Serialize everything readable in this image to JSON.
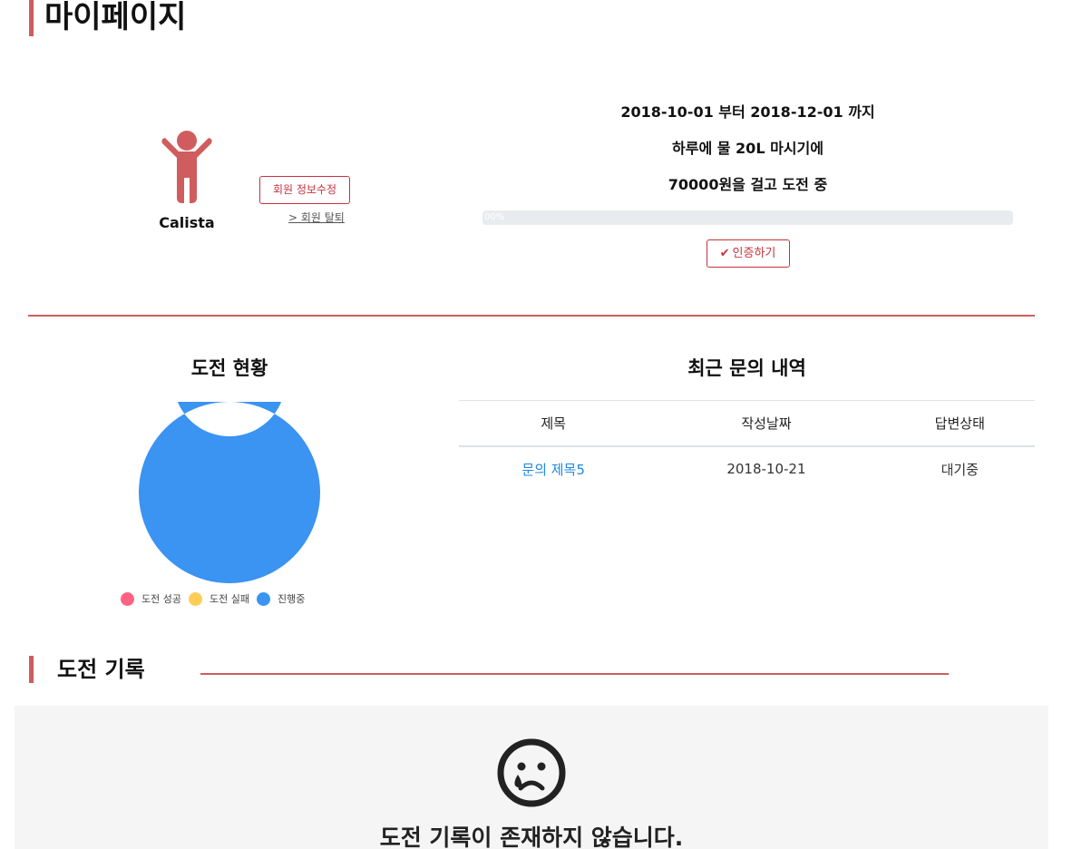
{
  "page": {
    "title": "마이페이지"
  },
  "profile": {
    "name": "Calista",
    "edit_button": "회원 정보수정",
    "withdraw_link": "> 회원 탈퇴"
  },
  "challenge": {
    "period": "2018-10-01 부터 2018-12-01 까지",
    "goal": "하루에 물 20L 마시기에",
    "bet": "70000원을 걸고 도전 중",
    "progress_label": "00%",
    "progress_value": 0,
    "verify_button": "인증하기"
  },
  "status": {
    "title": "도전 현황",
    "legend": [
      {
        "label": "도전 성공",
        "color": "#ff6384"
      },
      {
        "label": "도전 실패",
        "color": "#ffcd56"
      },
      {
        "label": "진행중",
        "color": "#3b93f2"
      }
    ]
  },
  "chart_data": {
    "type": "pie",
    "categories": [
      "도전 성공",
      "도전 실패",
      "진행중"
    ],
    "values": [
      0,
      0,
      1
    ],
    "colors": [
      "#ff6384",
      "#ffcd56",
      "#3b93f2"
    ],
    "legend_position": "bottom"
  },
  "inquiries": {
    "title": "최근 문의 내역",
    "columns": [
      "제목",
      "작성날짜",
      "답변상태"
    ],
    "rows": [
      {
        "title": "문의 제목5",
        "date": "2018-10-21",
        "status": "대기중"
      }
    ]
  },
  "records": {
    "title": "도전 기록",
    "empty_message": "도전 기록이 존재하지 않습니다.",
    "empty_icon": "sad-face-icon"
  },
  "colors": {
    "accent": "#d05d5d",
    "button_red": "#c6323d",
    "link_blue": "#1e88e5"
  }
}
